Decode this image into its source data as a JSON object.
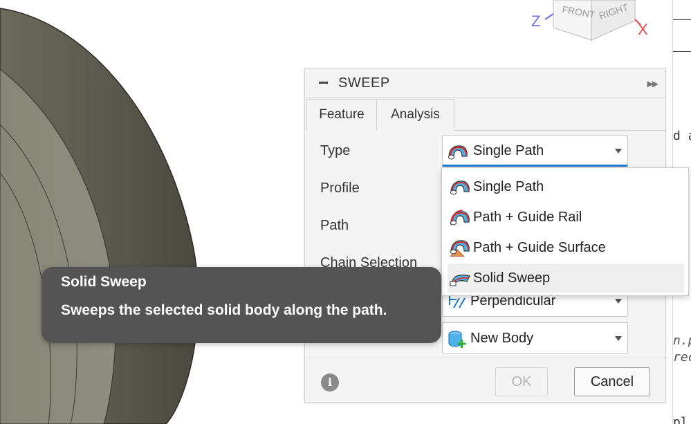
{
  "viewcube": {
    "faces": {
      "front": "FRONT",
      "right": "RIGHT"
    },
    "axes": {
      "z": "Z",
      "x": "X"
    },
    "colors": {
      "z": "#6f6fe6",
      "x": "#e84848"
    }
  },
  "doc": {
    "lines": [
      "d a",
      "n.p",
      "rec",
      "pl"
    ]
  },
  "panel": {
    "title": "SWEEP",
    "tabs": [
      {
        "label": "Feature",
        "active": true
      },
      {
        "label": "Analysis",
        "active": false
      }
    ],
    "rows": {
      "type": "Type",
      "profile": "Profile",
      "path": "Path",
      "chain": "Chain Selection"
    },
    "type_value": "Single Path",
    "orientation_value": "Perpendicular",
    "operation_value": "New Body",
    "ok_label": "OK",
    "cancel_label": "Cancel",
    "accent": "#1b7bd0"
  },
  "dropdown": {
    "options": [
      {
        "label": "Single Path",
        "icon": "single-path-icon"
      },
      {
        "label": "Path + Guide Rail",
        "icon": "path-guide-rail-icon"
      },
      {
        "label": "Path + Guide Surface",
        "icon": "path-guide-surface-icon"
      },
      {
        "label": "Solid Sweep",
        "icon": "solid-sweep-icon",
        "highlighted": true
      }
    ]
  },
  "tooltip": {
    "title": "Solid Sweep",
    "body": "Sweeps the selected solid body along the path."
  }
}
